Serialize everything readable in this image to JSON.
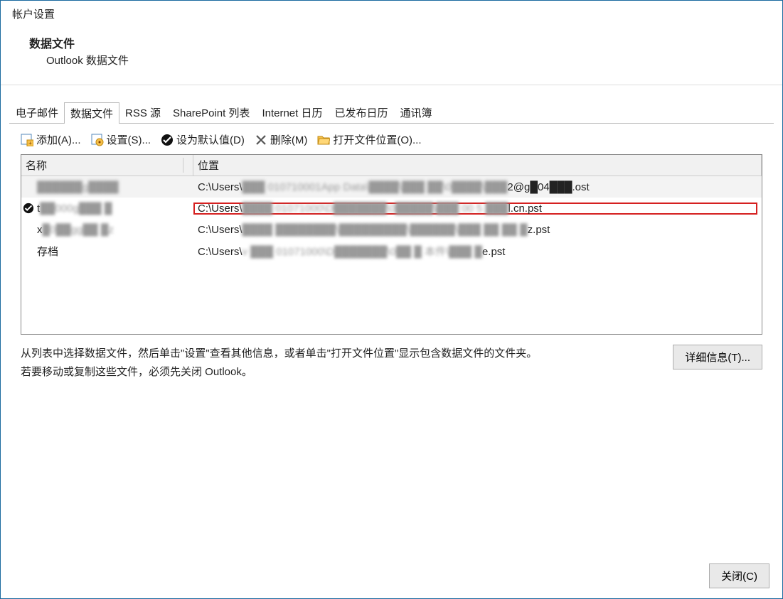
{
  "dialog": {
    "title": "帐户设置"
  },
  "header": {
    "section_title": "数据文件",
    "subtitle": "Outlook 数据文件"
  },
  "tabs": [
    {
      "label": "电子邮件",
      "active": false
    },
    {
      "label": "数据文件",
      "active": true
    },
    {
      "label": "RSS 源",
      "active": false
    },
    {
      "label": "SharePoint 列表",
      "active": false
    },
    {
      "label": "Internet 日历",
      "active": false
    },
    {
      "label": "已发布日历",
      "active": false
    },
    {
      "label": "通讯簿",
      "active": false
    }
  ],
  "toolbar": {
    "add": "添加(A)...",
    "settings": "设置(S)...",
    "default": "设为默认值(D)",
    "delete": "删除(M)",
    "open_loc": "打开文件位置(O)..."
  },
  "table": {
    "col_name": "名称",
    "col_loc": "位置",
    "rows": [
      {
        "default": false,
        "name_visible": "",
        "name_ghost": "██████g████",
        "loc_prefix": "C:\\Users\\",
        "loc_ghost": "███ 010710001App Data\\████\\███ ██\\0████\\███",
        "loc_suffix": "2@g█04███.ost",
        "highlight": false
      },
      {
        "default": true,
        "name_visible": "t",
        "name_ghost": "██000g███ █",
        "loc_prefix": "C:\\Users\\",
        "loc_ghost": "████ 01071000\\D███████\\0█████\\███ 00 5 ███",
        "loc_suffix": "l.cn.pst",
        "highlight": true
      },
      {
        "default": false,
        "name_visible": "x",
        "name_ghost": "█0██gg██ █z",
        "loc_prefix": "C:\\Users\\",
        "loc_ghost": "████ ████████\\█████████\\██████\\███ ██ ██ █",
        "loc_suffix": "z.pst",
        "highlight": false
      },
      {
        "default": false,
        "name_visible": "存档",
        "name_ghost": "",
        "loc_prefix": "C:\\Users\\",
        "loc_ghost": "v ███ 01071000\\D███████\\0██ █ 本件\\███ █",
        "loc_suffix": "e.pst",
        "highlight": false
      }
    ]
  },
  "description": {
    "line1": "从列表中选择数据文件，然后单击\"设置\"查看其他信息，或者单击\"打开文件位置\"显示包含数据文件的文件夹。",
    "line2": "若要移动或复制这些文件，必须先关闭 Outlook。"
  },
  "buttons": {
    "details": "详细信息(T)...",
    "close": "关闭(C)"
  }
}
